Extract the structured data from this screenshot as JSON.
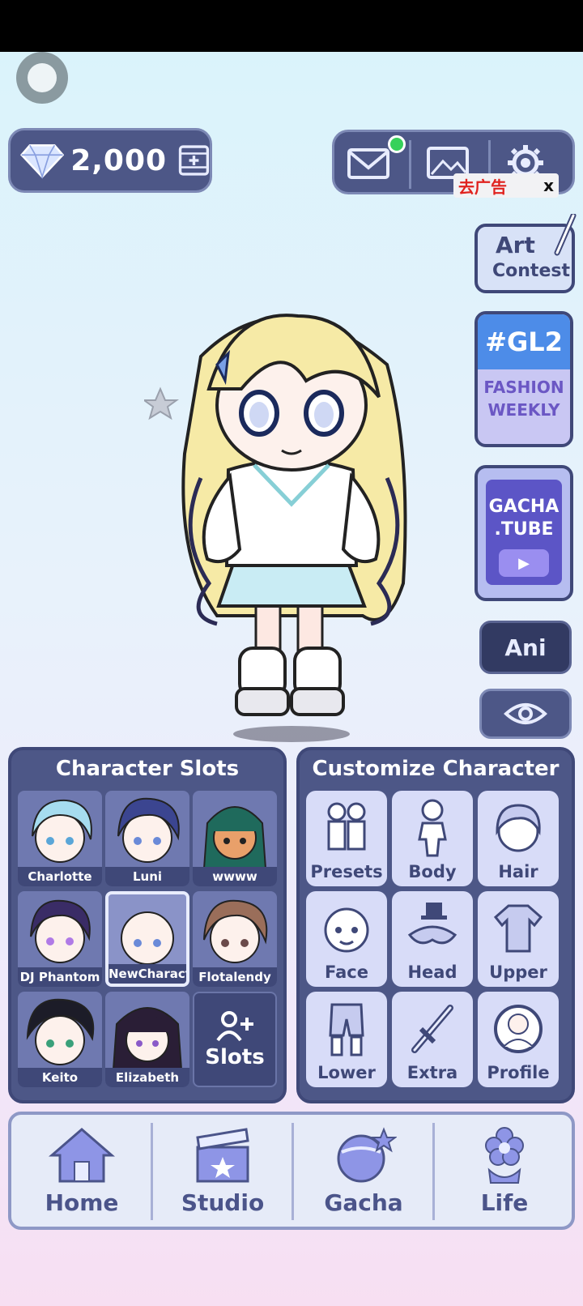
{
  "currency": {
    "gems": "2,000"
  },
  "ad": {
    "label": "去广告",
    "close": "x"
  },
  "side": {
    "art_contest": {
      "line1": "Art",
      "line2": "Contest"
    },
    "gl2": {
      "tag": "#GL2",
      "line1": "FASHION",
      "line2": "WEEKLY"
    },
    "gacha_tube": {
      "line1": "GACHA",
      "line2": ".TUBE"
    },
    "ani_label": "Ani"
  },
  "character_slots": {
    "title": "Character Slots",
    "slots": [
      {
        "name": "Charlotte"
      },
      {
        "name": "Luni"
      },
      {
        "name": "wwww"
      },
      {
        "name": "DJ Phantom"
      },
      {
        "name": "NewCharacte"
      },
      {
        "name": "Flotalendy"
      },
      {
        "name": "Keito"
      },
      {
        "name": "Elizabeth"
      }
    ],
    "add_label": "Slots"
  },
  "customize": {
    "title": "Customize Character",
    "items": [
      {
        "label": "Presets"
      },
      {
        "label": "Body"
      },
      {
        "label": "Hair"
      },
      {
        "label": "Face"
      },
      {
        "label": "Head"
      },
      {
        "label": "Upper"
      },
      {
        "label": "Lower"
      },
      {
        "label": "Extra"
      },
      {
        "label": "Profile"
      }
    ]
  },
  "nav": [
    {
      "label": "Home",
      "icon": "house-icon"
    },
    {
      "label": "Studio",
      "icon": "clapperboard-icon"
    },
    {
      "label": "Gacha",
      "icon": "gacha-orb-icon"
    },
    {
      "label": "Life",
      "icon": "flower-icon"
    }
  ],
  "colors": {
    "panel": "#4d5787",
    "panel_border": "#3f4878",
    "notification_dot": "#36d15a",
    "ad_text": "#e0221e"
  }
}
